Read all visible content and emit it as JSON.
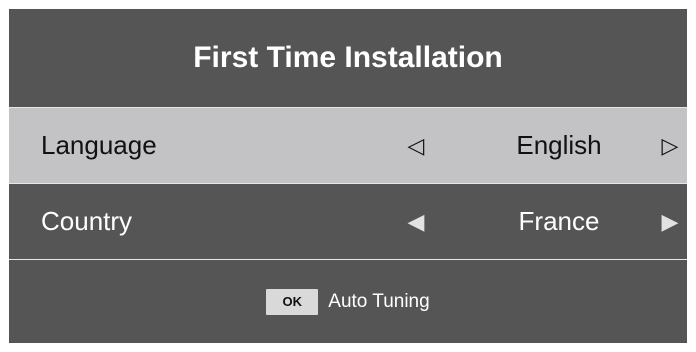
{
  "screen": {
    "title": "First Time Installation"
  },
  "settings": [
    {
      "label": "Language",
      "value": "English",
      "left_arrow": "◁",
      "right_arrow": "▷",
      "selected": true
    },
    {
      "label": "Country",
      "value": "France",
      "left_arrow": "◀",
      "right_arrow": "▶",
      "selected": false
    }
  ],
  "footer": {
    "key_label": "OK",
    "action_label": "Auto Tuning"
  },
  "colors": {
    "panel_background": "#555555",
    "selected_row_background": "#c3c3c5",
    "divider": "#e6e6e6",
    "text_light": "#ffffff",
    "text_dark": "#111111"
  }
}
